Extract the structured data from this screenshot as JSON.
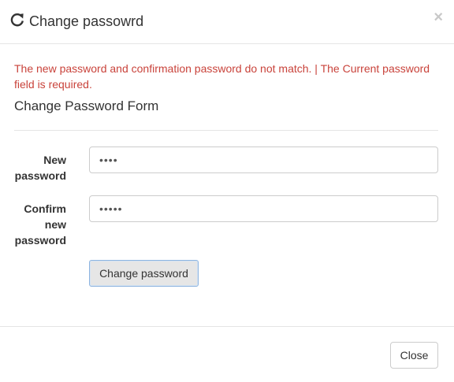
{
  "header": {
    "title": "Change passowrd",
    "close_symbol": "×",
    "icon": "refresh-icon"
  },
  "errors": {
    "summary": "The new password and confirmation password do not match. | The Current password field is required.",
    "color": "#c9433b"
  },
  "form": {
    "heading": "Change Password Form",
    "new_password": {
      "label_line1": "New",
      "label_line2": "password",
      "value": "••••"
    },
    "confirm_password": {
      "label_line1": "Confirm",
      "label_line2": "new",
      "label_line3": "password",
      "value": "•••••"
    },
    "submit_label": "Change password"
  },
  "footer": {
    "close_label": "Close"
  }
}
